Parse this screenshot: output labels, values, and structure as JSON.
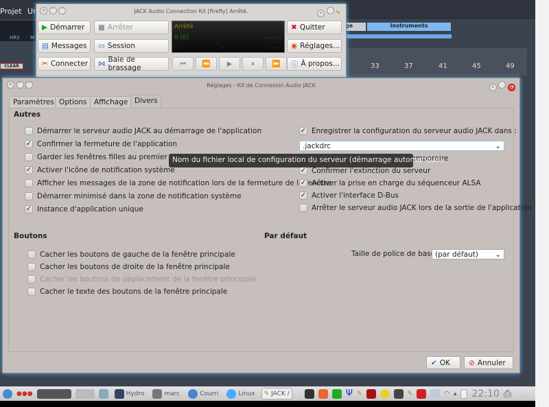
{
  "background_app": {
    "menu": [
      "Projet",
      "Ur"
    ],
    "clock_units": [
      "HRS",
      "M"
    ],
    "clear_label": "CLEAR",
    "tab_partial": "ge",
    "instruments_label": "Instruments",
    "ruler": [
      "33",
      "37",
      "41",
      "45",
      "49"
    ]
  },
  "jack": {
    "title": "JACK Audio Connection Kit [firefly] Arrêté.",
    "buttons": {
      "start": "Démarrer",
      "stop": "Arrêter",
      "messages": "Messages",
      "session": "Session",
      "connect": "Connecter",
      "patchbay": "Baie de brassage",
      "quit": "Quitter",
      "settings": "Réglages...",
      "about": "À propos..."
    },
    "display": {
      "status": "Arrêté",
      "xruns": "0 (0)",
      "time": "--:--:--",
      "left": "--",
      "mid": "--",
      "right": "-.-.--"
    },
    "colors": {
      "status": "#8a8a00",
      "xruns": "#1a8a1a"
    }
  },
  "dialog": {
    "title": "Réglages - Kit de Connexion Audio JACK",
    "tabs": [
      "Paramètres",
      "Options",
      "Affichage",
      "Divers"
    ],
    "active_tab": "Divers",
    "autres": {
      "heading": "Autres",
      "left": [
        {
          "label": "Démarrer le serveur audio JACK au démarrage de l'application",
          "checked": false
        },
        {
          "label": "Confirmer la fermeture de l'application",
          "checked": true
        },
        {
          "label": "Garder les fenêtres filles au premier plan",
          "checked": false
        },
        {
          "label": "Activer l'icône de notification système",
          "checked": true
        },
        {
          "label": "Afficher les messages de la zone de notification lors de la fermeture de la fenêtre",
          "checked": false
        },
        {
          "label": "Démarrer minimisé dans la zone de notification système",
          "checked": false
        },
        {
          "label": "Instance d'application unique",
          "checked": true
        }
      ],
      "save_config": {
        "label": "Enregistrer la configuration du serveur audio JACK dans :",
        "checked": true
      },
      "config_file": ".jackdrc",
      "right": [
        {
          "label": "Confirmer la configuration temporaire",
          "checked": false
        },
        {
          "label": "Confirmer l'extinction du serveur",
          "checked": true
        },
        {
          "label": "Activer la prise en charge du séquenceur ALSA",
          "checked": true
        },
        {
          "label": "Activer l'interface D-Bus",
          "checked": true
        },
        {
          "label": "Arrêter le serveur audio JACK lors de la sortie de l'application",
          "checked": false
        }
      ]
    },
    "tooltip": "Nom du fichier local de configuration du serveur (démarrage automatique)",
    "boutons": {
      "heading": "Boutons",
      "items": [
        {
          "label": "Cacher les boutons de gauche de la fenêtre principale",
          "checked": false,
          "enabled": true
        },
        {
          "label": "Cacher les boutons de droite de la fenêtre principale",
          "checked": false,
          "enabled": true
        },
        {
          "label": "Cacher les boutons de déplacement de la fenêtre principale",
          "checked": false,
          "enabled": false
        },
        {
          "label": "Cacher le texte des boutons de la fenêtre principale",
          "checked": false,
          "enabled": true
        }
      ]
    },
    "defaut": {
      "heading": "Par défaut",
      "font_label": "Taille de police de base :",
      "font_value": "(par défaut)"
    },
    "ok": "OK",
    "cancel": "Annuler"
  },
  "taskbar": {
    "tasks": [
      "Hydro",
      "marc",
      "Courri",
      "Linux",
      "JACK /"
    ],
    "clock": "22:10"
  }
}
